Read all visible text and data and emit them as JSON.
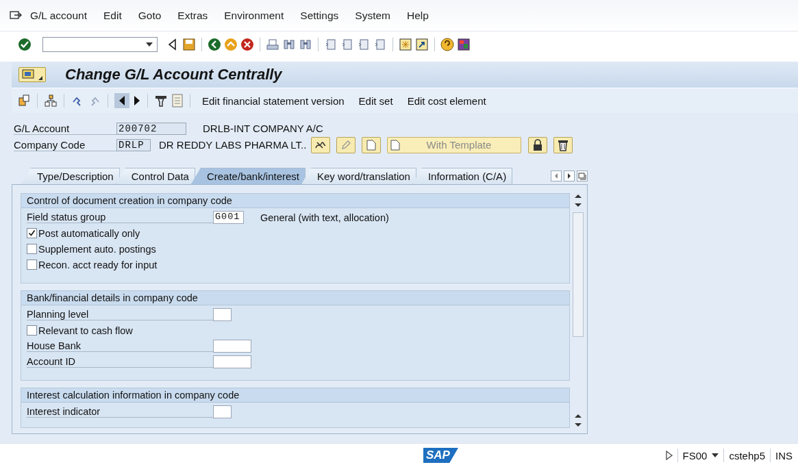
{
  "menu": [
    "G/L account",
    "Edit",
    "Goto",
    "Extras",
    "Environment",
    "Settings",
    "System",
    "Help"
  ],
  "title": "Change G/L Account Centrally",
  "app_toolbar": {
    "buttons": [
      "Edit financial statement version",
      "Edit set",
      "Edit cost element"
    ]
  },
  "header": {
    "gl_account": {
      "label": "G/L Account",
      "value": "200702",
      "description": "DRLB-INT COMPANY A/C"
    },
    "company_code": {
      "label": "Company Code",
      "value": "DRLP",
      "description": "DR REDDY LABS PHARMA LT.."
    },
    "template_button": {
      "label": "With Template",
      "disabled": true
    }
  },
  "tabs": [
    {
      "label": "Type/Description",
      "selected": false
    },
    {
      "label": "Control Data",
      "selected": false
    },
    {
      "label": "Create/bank/interest",
      "selected": true
    },
    {
      "label": "Key word/translation",
      "selected": false
    },
    {
      "label": "Information (C/A)",
      "selected": false
    }
  ],
  "groups": [
    {
      "title": "Control of document creation in company code",
      "rows": [
        {
          "kind": "field",
          "label": "Field status group",
          "value": "G001",
          "description": "General (with text, allocation)"
        },
        {
          "kind": "checkbox",
          "label": "Post automatically only",
          "checked": true
        },
        {
          "kind": "checkbox",
          "label": "Supplement auto. postings",
          "checked": false
        },
        {
          "kind": "checkbox",
          "label": "Recon. acct ready for input",
          "checked": false
        }
      ]
    },
    {
      "title": "Bank/financial details in company code",
      "rows": [
        {
          "kind": "field",
          "label": "Planning level"
        },
        {
          "kind": "checkbox",
          "label": "Relevant to cash flow",
          "checked": false
        },
        {
          "kind": "field",
          "label": "House Bank"
        },
        {
          "kind": "field",
          "label": "Account ID"
        }
      ]
    },
    {
      "title": "Interest calculation information in company code",
      "rows": [
        {
          "kind": "field",
          "label": "Interest indicator"
        }
      ]
    }
  ],
  "status_bar": {
    "logo": "SAP",
    "transaction": "FS00",
    "system": "cstehp5",
    "mode": "INS"
  }
}
